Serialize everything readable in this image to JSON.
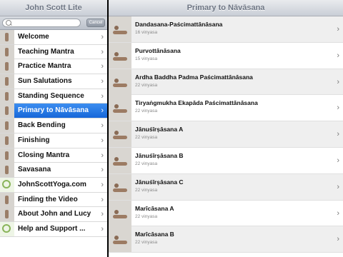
{
  "left": {
    "title": "John Scott Lite",
    "cancel_label": "Cancel",
    "items": [
      {
        "label": "Welcome",
        "icon": "yoga-pose-thumbnail"
      },
      {
        "label": "Teaching Mantra",
        "icon": "yoga-pose-thumbnail"
      },
      {
        "label": "Practice Mantra",
        "icon": "yoga-pose-thumbnail"
      },
      {
        "label": "Sun Salutations",
        "icon": "yoga-pose-thumbnail"
      },
      {
        "label": "Standing Sequence",
        "icon": "yoga-pose-thumbnail"
      },
      {
        "label": "Primary to Nāvāsana",
        "icon": "yoga-pose-thumbnail"
      },
      {
        "label": "Back Bending",
        "icon": "yoga-pose-thumbnail"
      },
      {
        "label": "Finishing",
        "icon": "yoga-pose-thumbnail"
      },
      {
        "label": "Closing Mantra",
        "icon": "yoga-pose-thumbnail"
      },
      {
        "label": "Savasana",
        "icon": "yoga-pose-thumbnail"
      },
      {
        "label": "JohnScottYoga.com",
        "icon": "green-logo"
      },
      {
        "label": "Finding the Video",
        "icon": "yoga-pose-thumbnail"
      },
      {
        "label": "About John and Lucy",
        "icon": "yoga-pose-thumbnail"
      },
      {
        "label": "Help and Support ...",
        "icon": "green-logo"
      }
    ],
    "selected_index": 5
  },
  "right": {
    "title": "Primary to Nāvāsana",
    "poses": [
      {
        "name": "Dandasana-Paścimattānāsana",
        "vinyasa": "16 vinyasa"
      },
      {
        "name": "Purvottānāsana",
        "vinyasa": "15 vinyasa"
      },
      {
        "name": "Ardha Baddha Padma Paścimattānāsana",
        "vinyasa": "22 vinyasa"
      },
      {
        "name": "Tiryaṅgmukha Ekapāda Paścimattānāsana",
        "vinyasa": "22 vinyasa"
      },
      {
        "name": "Jānuśīrṣāsana A",
        "vinyasa": "22 vinyasa"
      },
      {
        "name": "Jānuśīrṣāsana B",
        "vinyasa": "22 vinyasa"
      },
      {
        "name": "Jānuśīrṣāsana C",
        "vinyasa": "22 vinyasa"
      },
      {
        "name": "Marīcāsana A",
        "vinyasa": "22 vinyasa"
      },
      {
        "name": "Marīcāsana B",
        "vinyasa": "22 vinyasa"
      }
    ]
  },
  "colors": {
    "selected": "#1767d9",
    "navbar_text": "#6d7583"
  }
}
